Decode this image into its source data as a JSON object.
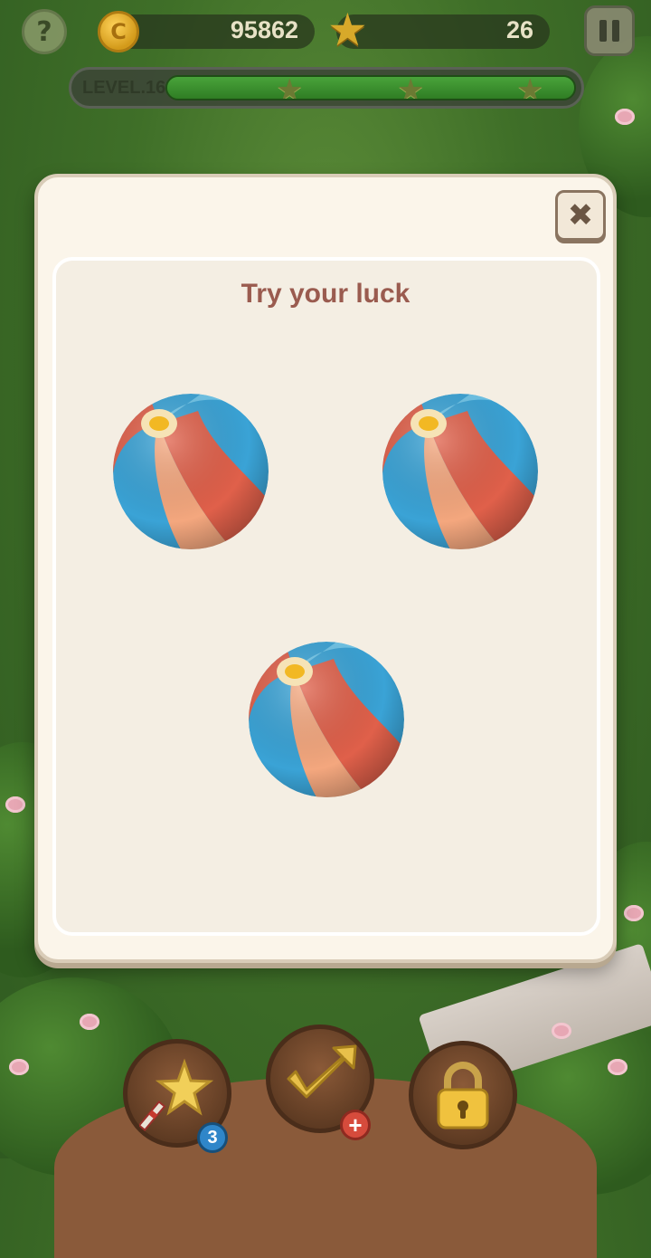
{
  "hud": {
    "help_label": "?",
    "coin_symbol": "C",
    "coins": "95862",
    "stars": "26",
    "level_label": "LEVEL.16",
    "level_progress": 1.0,
    "milestone_stars": 3
  },
  "dialog": {
    "close_label": "✖",
    "title": "Try your luck",
    "balls": [
      {
        "id": "ball-1"
      },
      {
        "id": "ball-2"
      },
      {
        "id": "ball-3"
      }
    ]
  },
  "boosters": {
    "magic_wand_count": "3",
    "hammer_add_label": "+",
    "lock_icon": "padlock-icon"
  },
  "colors": {
    "ball_blue": "#3aa3d6",
    "ball_red": "#e0604a",
    "title": "#9a5b4f",
    "panel": "#f4eee3"
  }
}
